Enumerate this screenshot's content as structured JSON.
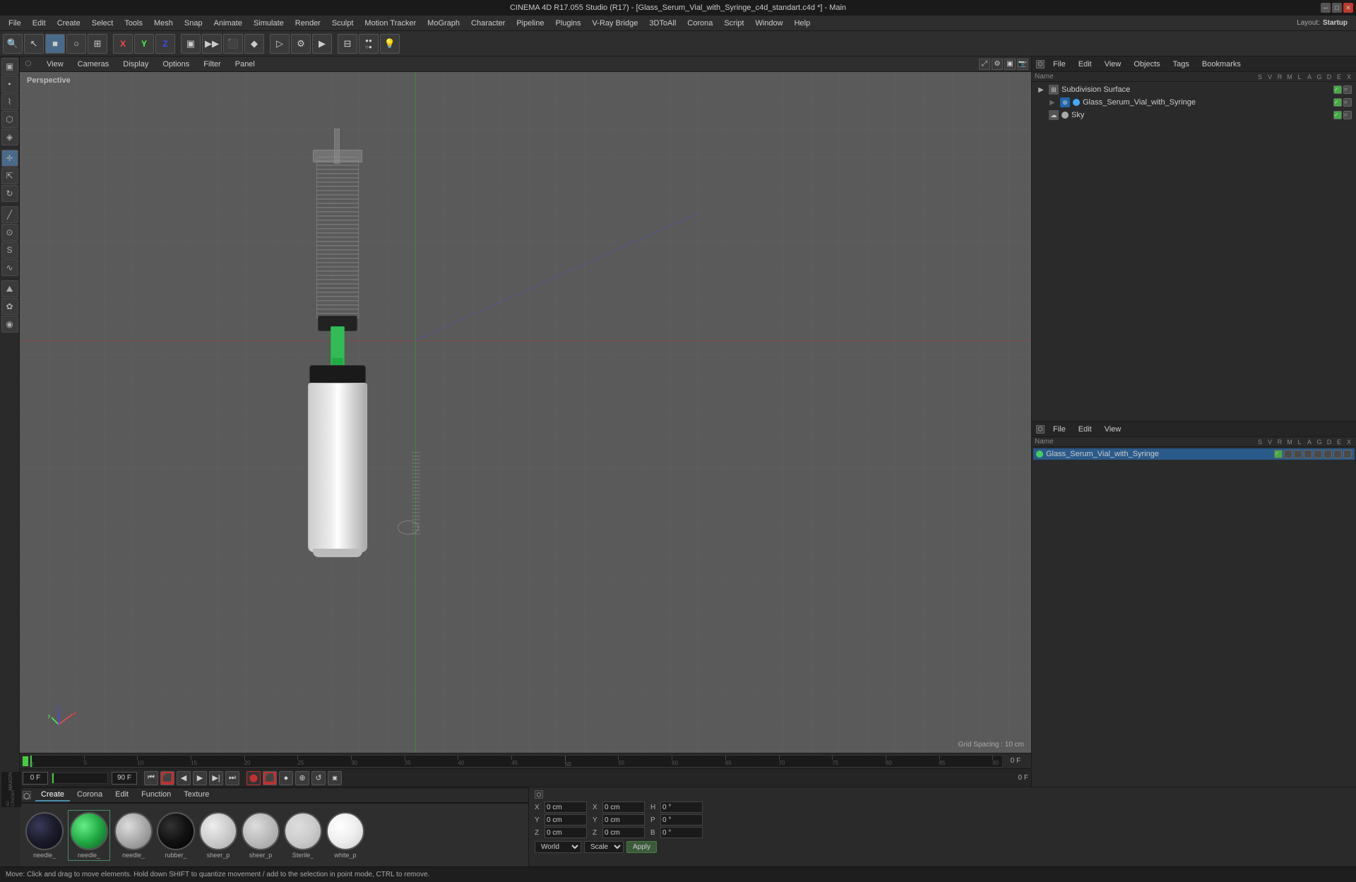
{
  "titlebar": {
    "title": "CINEMA 4D R17.055 Studio (R17) - [Glass_Serum_Vial_with_Syringe_c4d_standart.c4d *] - Main",
    "min": "─",
    "max": "□",
    "close": "✕"
  },
  "menubar": {
    "items": [
      "File",
      "Edit",
      "Create",
      "Select",
      "Tools",
      "Mesh",
      "Snap",
      "Animate",
      "Simulate",
      "Render",
      "Sculpt",
      "Motion Tracker",
      "MoGraph",
      "Character",
      "Pipeline",
      "Plugins",
      "V-Ray Bridge",
      "3DToAll",
      "Corona",
      "Script",
      "Window",
      "Help"
    ]
  },
  "toolbar": {
    "layout_label": "Layout:",
    "layout_value": "Startup",
    "tools": [
      "↖",
      "□",
      "○",
      "⊞",
      "✕",
      "Y",
      "Z",
      "▣",
      "▶",
      "⬛",
      "⊕",
      "◑",
      "✦",
      "⊕",
      "★",
      "⊟",
      "⊕",
      "●",
      "⊕",
      "⊞",
      "💡"
    ]
  },
  "viewport": {
    "perspective_label": "Perspective",
    "header_menus": [
      "View",
      "Cameras",
      "Display",
      "Options",
      "Filter",
      "Panel"
    ],
    "grid_spacing": "Grid Spacing : 10 cm"
  },
  "objects_panel": {
    "header_menus": [
      "File",
      "Edit",
      "View",
      "Objects",
      "Tags",
      "Bookmarks"
    ],
    "columns": {
      "name": "Name",
      "flags": [
        "S",
        "V",
        "R",
        "M",
        "L",
        "A",
        "G",
        "D",
        "E",
        "X"
      ]
    },
    "items": [
      {
        "name": "Subdivision Surface",
        "indent": 0,
        "icon": "⊞",
        "color": null,
        "has_arrow": true,
        "flags": [
          "●",
          "○",
          "●"
        ]
      },
      {
        "name": "Glass_Serum_Vial_with_Syringe",
        "indent": 1,
        "icon": "⊕",
        "color": "#44aaff",
        "has_arrow": false,
        "flags": [
          "●",
          "○",
          "●"
        ],
        "selected": false
      },
      {
        "name": "Sky",
        "indent": 0,
        "icon": "☁",
        "color": "#aaaaaa",
        "has_arrow": false,
        "flags": [
          "●",
          "○"
        ]
      }
    ]
  },
  "materials_panel": {
    "header_menus": [
      "File",
      "Edit",
      "View"
    ],
    "columns": {
      "name": "Name",
      "flags": [
        "S",
        "V",
        "R",
        "M",
        "L",
        "A",
        "G",
        "D",
        "E",
        "X"
      ]
    },
    "items": [
      {
        "name": "Glass_Serum_Vial_with_Syringe",
        "color": "#44cc66",
        "selected": true
      }
    ]
  },
  "mat_tabs": {
    "items": [
      "Create",
      "Corona",
      "Edit",
      "Function",
      "Texture"
    ]
  },
  "mat_thumbs": [
    {
      "label": "needle_",
      "gradient": [
        "#1a1a2a",
        "#2a2a3a",
        "#111122"
      ]
    },
    {
      "label": "needle_",
      "gradient": [
        "#22aa44",
        "#44cc66",
        "#11882a"
      ]
    },
    {
      "label": "needle_",
      "gradient": [
        "#aaaaaa",
        "#cccccc",
        "#888888"
      ]
    },
    {
      "label": "rubber_",
      "gradient": [
        "#111111",
        "#222222",
        "#000000"
      ]
    },
    {
      "label": "sheer_p",
      "gradient": [
        "#dddddd",
        "#eeeeee",
        "#bbbbbb"
      ]
    },
    {
      "label": "sheer_p",
      "gradient": [
        "#cccccc",
        "#dddddd",
        "#aaaaaa"
      ]
    },
    {
      "label": "Sterile_",
      "gradient": [
        "#cccccc",
        "#dddddd",
        "#aaaaaa"
      ]
    },
    {
      "label": "white_p",
      "gradient": [
        "#dddddd",
        "#eeeeee",
        "#bbbbbb"
      ]
    }
  ],
  "coordinates": {
    "x_label": "X",
    "x_val": "0 cm",
    "px_label": "X",
    "px_val": "0 cm",
    "h_label": "H",
    "h_val": "0 °",
    "y_label": "Y",
    "y_val": "0 cm",
    "py_label": "Y",
    "py_val": "0 cm",
    "p_label": "P",
    "p_val": "0 °",
    "z_label": "Z",
    "z_val": "0 cm",
    "pz_label": "Z",
    "pz_val": "0 cm",
    "b_label": "B",
    "b_val": "0 °",
    "world_label": "World",
    "scale_label": "Scale",
    "apply_label": "Apply"
  },
  "timeline": {
    "current_frame": "0 F",
    "max_frames": "90 F",
    "frame_input": "0 F",
    "frame_max": "90 F",
    "ticks": [
      0,
      5,
      10,
      15,
      20,
      25,
      30,
      35,
      40,
      45,
      50,
      55,
      60,
      65,
      70,
      75,
      80,
      85,
      90
    ]
  },
  "statusbar": {
    "text": "Move: Click and drag to move elements. Hold down SHIFT to quantize movement / add to the selection in point mode, CTRL to remove."
  }
}
